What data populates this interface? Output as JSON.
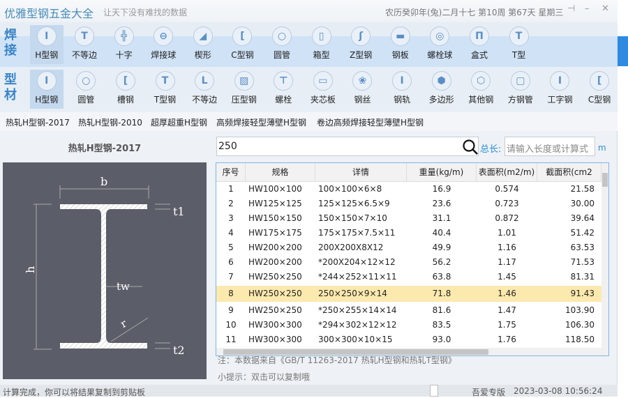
{
  "title": {
    "app_name": "优雅型钢五金大全",
    "slogan": "让天下没有难找的数据",
    "date_info": "农历癸卯年(兔)二月十七 第10周 第67天 星期三",
    "pin_icon": "pin-icon",
    "minimize_icon": "minimize-icon",
    "close_icon": "close-icon"
  },
  "weld": {
    "label": "焊接",
    "items": [
      {
        "label": "H型钢",
        "g": "I"
      },
      {
        "label": "不等边",
        "g": "T"
      },
      {
        "label": "十字",
        "g": "╬"
      },
      {
        "label": "焊接球",
        "g": "⊖"
      },
      {
        "label": "楔形",
        "g": "◢"
      },
      {
        "label": "C型钢",
        "g": "["
      },
      {
        "label": "圆管",
        "g": "○"
      },
      {
        "label": "箱型",
        "g": "▯"
      },
      {
        "label": "Z型钢",
        "g": "ʃ"
      },
      {
        "label": "钢板",
        "g": "▬"
      },
      {
        "label": "螺栓球",
        "g": "◎"
      },
      {
        "label": "盒式",
        "g": "Π"
      },
      {
        "label": "T型",
        "g": "T"
      }
    ]
  },
  "section": {
    "label": "型材",
    "items": [
      {
        "label": "H型钢",
        "g": "I"
      },
      {
        "label": "圆管",
        "g": "○"
      },
      {
        "label": "槽钢",
        "g": "["
      },
      {
        "label": "T型钢",
        "g": "T"
      },
      {
        "label": "不等边",
        "g": "L"
      },
      {
        "label": "压型钢",
        "g": "▨"
      },
      {
        "label": "螺栓",
        "g": "⊤"
      },
      {
        "label": "夹芯板",
        "g": "▭"
      },
      {
        "label": "钢丝",
        "g": "❀"
      },
      {
        "label": "钢轨",
        "g": "I"
      },
      {
        "label": "多边形",
        "g": "⬢"
      },
      {
        "label": "其他钢",
        "g": "⬡"
      },
      {
        "label": "方钢管",
        "g": "▢"
      },
      {
        "label": "工字钢",
        "g": "I"
      },
      {
        "label": "C型钢",
        "g": "["
      }
    ],
    "scroll_arrows": "◀▶"
  },
  "subtabs": [
    "热轧H型钢-2017",
    "热轧H型钢-2010",
    "超厚超重H型钢",
    "高频焊接轻型薄壁H型钢",
    "卷边高频焊接轻型薄壁H型钢"
  ],
  "drawing": {
    "title": "热轧H型钢-2017",
    "labels": {
      "b": "b",
      "h": "h",
      "t1": "t1",
      "t2": "t2",
      "tw": "tw",
      "r": "r"
    }
  },
  "search": {
    "value": "250",
    "total_label": "总长:",
    "total_placeholder": "请输入长度或计算式",
    "unit": "m"
  },
  "table": {
    "headers": [
      "序号",
      "规格",
      "详情",
      "重量(kg/m)",
      "表面积(m2/m)",
      "截面积(cm2"
    ],
    "rows": [
      [
        "1",
        "HW100×100",
        "100×100×6×8",
        "16.9",
        "0.574",
        "21.58"
      ],
      [
        "2",
        "HW125×125",
        "125×125×6.5×9",
        "23.6",
        "0.723",
        "30.00"
      ],
      [
        "3",
        "HW150×150",
        "150×150×7×10",
        "31.1",
        "0.872",
        "39.64"
      ],
      [
        "4",
        "HW175×175",
        "175×175×7.5×11",
        "40.4",
        "1.01",
        "51.42"
      ],
      [
        "5",
        "HW200×200",
        "200X200X8X12",
        "49.9",
        "1.16",
        "63.53"
      ],
      [
        "6",
        "HW200×200",
        "*200X204×12×12",
        "56.2",
        "1.17",
        "71.53"
      ],
      [
        "7",
        "HW250×250",
        "*244×252×11×11",
        "63.8",
        "1.45",
        "81.31"
      ],
      [
        "8",
        "HW250×250",
        "250×250×9×14",
        "71.8",
        "1.46",
        "91.43"
      ],
      [
        "9",
        "HW250×250",
        "*250×255×14×14",
        "81.6",
        "1.47",
        "103.90"
      ],
      [
        "10",
        "HW300×300",
        "*294×302×12×12",
        "83.5",
        "1.75",
        "106.30"
      ],
      [
        "11",
        "HW300×300",
        "300×300×10×15",
        "93.0",
        "1.76",
        "118.50"
      ]
    ],
    "selected_row": 8,
    "highlight_color": "#fce9ae"
  },
  "note": "注：本数据来自《GB/T  11263-2017 热轧H型钢和热轧T型钢》",
  "tip": "小提示：双击可以复制哦",
  "status": {
    "left": "计算完成，你可以将结果复制到剪贴板",
    "edition": "吾爱专版",
    "datetime": "2023-03-08 10:56:24"
  },
  "colors": {
    "accent": "#3a85c7",
    "drawing_bg": "#5b5e68"
  }
}
